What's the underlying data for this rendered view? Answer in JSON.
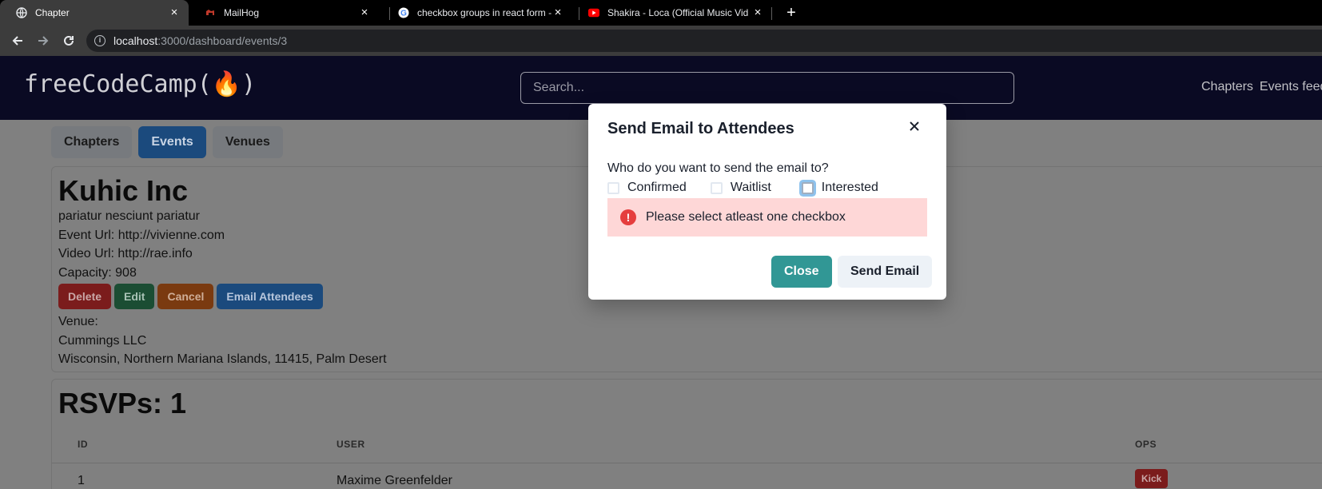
{
  "browser": {
    "tabs": [
      {
        "title": "Chapter",
        "active": true,
        "icon": "globe-icon"
      },
      {
        "title": "MailHog",
        "active": false,
        "icon": "mailhog-pig-icon"
      },
      {
        "title": "checkbox groups in react form - G",
        "active": false,
        "icon": "google-icon"
      },
      {
        "title": "Shakira - Loca (Official Music Vid",
        "active": false,
        "icon": "youtube-icon"
      }
    ],
    "url_host": "localhost",
    "url_path": ":3000/dashboard/events/3"
  },
  "header": {
    "logo": "freeCodeCamp(🔥)",
    "search_placeholder": "Search...",
    "links": [
      "Chapters",
      "Events feed"
    ]
  },
  "dashboard_tabs": [
    {
      "label": "Chapters",
      "active": false
    },
    {
      "label": "Events",
      "active": true
    },
    {
      "label": "Venues",
      "active": false
    }
  ],
  "event": {
    "title": "Kuhic Inc",
    "description": "pariatur nesciunt pariatur",
    "event_url": "Event Url: http://vivienne.com",
    "video_url": "Video Url: http://rae.info",
    "capacity": "Capacity: 908",
    "buttons": {
      "delete": "Delete",
      "edit": "Edit",
      "cancel": "Cancel",
      "email": "Email Attendees"
    },
    "venue_label": "Venue:",
    "venue_name": "Cummings LLC",
    "venue_address": "Wisconsin, Northern Mariana Islands, 11415, Palm Desert"
  },
  "rsvps": {
    "title": "RSVPs: 1",
    "columns": {
      "id": "ID",
      "user": "USER",
      "ops": "OPS"
    },
    "rows": [
      {
        "id": "1",
        "user": "Maxime Greenfelder",
        "op": "Kick"
      }
    ]
  },
  "modal": {
    "title": "Send Email to Attendees",
    "question": "Who do you want to send the email to?",
    "checkboxes": {
      "confirmed": "Confirmed",
      "waitlist": "Waitlist",
      "interested": "Interested"
    },
    "error": "Please select atleast one checkbox",
    "close_label": "Close",
    "send_label": "Send Email"
  },
  "colors": {
    "accent_teal": "#319795",
    "error_bg": "#fed7d7",
    "error_icon": "#e53e3e",
    "header_bg": "#0a0a23"
  }
}
